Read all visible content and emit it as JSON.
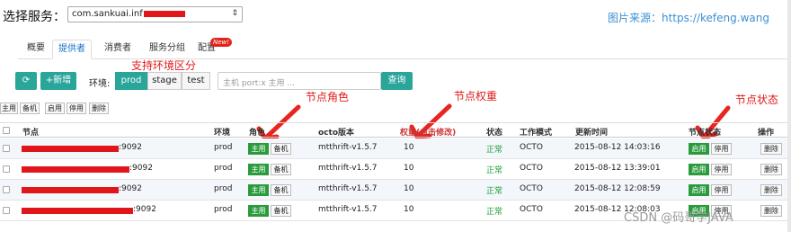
{
  "header": {
    "service_label": "选择服务：",
    "service_value": "com.sankuai.inf",
    "source": "图片来源：https://kefeng.wang"
  },
  "tabs": [
    {
      "label": "概要"
    },
    {
      "label": "提供者"
    },
    {
      "label": "消费者"
    },
    {
      "label": "服务分组"
    },
    {
      "label": "配置"
    }
  ],
  "new_badge": "New!",
  "annotations": {
    "env": "支持环境区分",
    "role": "节点角色",
    "weight": "节点权重",
    "status": "节点状态"
  },
  "toolbar": {
    "refresh_icon": "refresh-icon",
    "add_label": "+新增",
    "env_label": "环境:",
    "envs": [
      "prod",
      "stage",
      "test"
    ],
    "active_env": "prod",
    "search_placeholder": "主机 port:x 主用 ...",
    "search_button": "查询"
  },
  "bulk": [
    "主用",
    "备机",
    "启用",
    "停用",
    "删除"
  ],
  "table": {
    "headers": {
      "node": "节点",
      "env": "环境",
      "role": "角色",
      "version": "octo版本",
      "weight": "权重(点击修改)",
      "state": "状态",
      "mode": "工作模式",
      "updated": "更新时间",
      "node_status": "节点状态",
      "action": "操作"
    },
    "rows": [
      {
        "node": ":9092",
        "env": "prod",
        "version": "mtthrift-v1.5.7",
        "weight": "10",
        "state": "正常",
        "mode": "OCTO",
        "updated": "2015-08-12 14:03:16"
      },
      {
        "node": ":9092",
        "env": "prod",
        "version": "mtthrift-v1.5.7",
        "weight": "10",
        "state": "正常",
        "mode": "OCTO",
        "updated": "2015-08-12 13:39:01"
      },
      {
        "node": ":9092",
        "env": "prod",
        "version": "mtthrift-v1.5.7",
        "weight": "10",
        "state": "正常",
        "mode": "OCTO",
        "updated": "2015-08-12 12:08:59"
      },
      {
        "node": ":9092",
        "env": "prod",
        "version": "mtthrift-v1.5.7",
        "weight": "10",
        "state": "正常",
        "mode": "OCTO",
        "updated": "2015-08-12 12:08:03"
      }
    ],
    "role_primary": "主用",
    "role_backup": "备机",
    "status_on": "启用",
    "status_off": "停用",
    "delete_label": "删除"
  },
  "watermark": "CSDN @码哥学JAVA",
  "colors": {
    "accent": "#2aa59a",
    "active_green": "#2a9b3c",
    "annotation": "#e21a1a",
    "link": "#3a8fd4"
  }
}
